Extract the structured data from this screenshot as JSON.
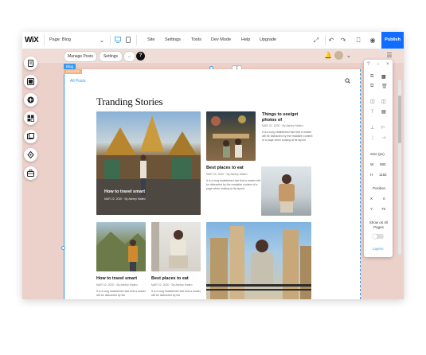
{
  "topbar": {
    "logo": "WiX",
    "page_label": "Page: Blog",
    "menu": [
      "Site",
      "Settings",
      "Tools",
      "Dev Mode",
      "Help",
      "Upgrade"
    ],
    "publish": "Publish"
  },
  "toolbar": {
    "manage_posts": "Manage Posts",
    "settings": "Settings",
    "help": "?"
  },
  "tags": {
    "blog": "Blog",
    "header": "HEADER"
  },
  "blog": {
    "all_posts": "All Posts",
    "heading": "Tranding Stories",
    "posts": [
      {
        "title": "How to travel smart",
        "meta": "MAR 22, 2020 · By Ashley Mateo"
      },
      {
        "title": "Things to see/get photos of",
        "meta": "MAR 22, 2020 · By Ashley Mateo",
        "excerpt": "It is a long established fact that a reader will be distracted by the readable content of a page when looking at its layout"
      },
      {
        "title": "Best places to eat",
        "meta": "MAR 22, 2020 · By Ashley Mateo",
        "excerpt": "It is a long established fact that a reader will be distracted by the readable content of a page when looking at its layout"
      },
      {
        "title": "How to travel smart",
        "meta": "MAR 22, 2020 · By Ashley Mateo",
        "excerpt": "It is a long established fact that a reader will be distracted by the"
      },
      {
        "title": "Best places to eat",
        "meta": "MAR 22, 2020 · By Ashley Mateo",
        "excerpt": "It is a long established fact that a reader will be distracted by the"
      }
    ]
  },
  "right_panel": {
    "size_label": "Size (px)",
    "w_label": "W",
    "w_value": "980",
    "h_label": "H",
    "h_value": "1182",
    "position_label": "Position",
    "x_label": "X",
    "x_value": "0",
    "y_label": "Y",
    "y_value": "75",
    "show_all_pages": "Show on All Pages",
    "layers": "Layers",
    "help": "?"
  },
  "colors": {
    "accent": "#3899ec",
    "publish": "#116dff",
    "stage": "#f1ddd8"
  }
}
